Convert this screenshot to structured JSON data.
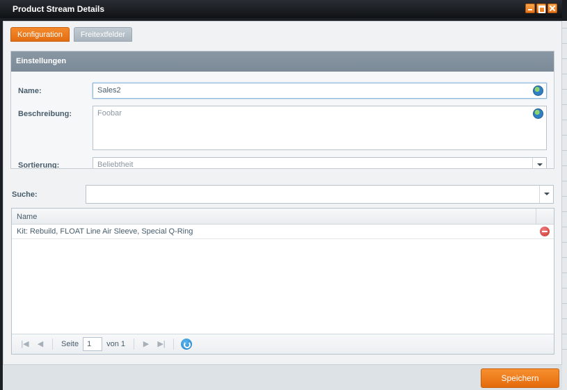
{
  "window": {
    "title": "Product Stream Details"
  },
  "tabs": [
    {
      "label": "Konfiguration",
      "active": true
    },
    {
      "label": "Freitextfelder",
      "active": false
    }
  ],
  "settings": {
    "header": "Einstellungen",
    "name_label": "Name:",
    "name_value": "Sales2",
    "description_label": "Beschreibung:",
    "description_value": "Foobar",
    "sort_label": "Sortierung:",
    "sort_value": "Beliebtheit"
  },
  "search": {
    "label": "Suche:",
    "value": ""
  },
  "grid": {
    "column_name": "Name",
    "rows": [
      {
        "name": "Kit: Rebuild, FLOAT Line Air Sleeve, Special Q-Ring"
      }
    ]
  },
  "pager": {
    "page_label": "Seite",
    "page_value": "1",
    "of_label": "von 1"
  },
  "footer": {
    "save_label": "Speichern"
  },
  "colors": {
    "accent": "#e97318",
    "header": "#7b8a98"
  }
}
